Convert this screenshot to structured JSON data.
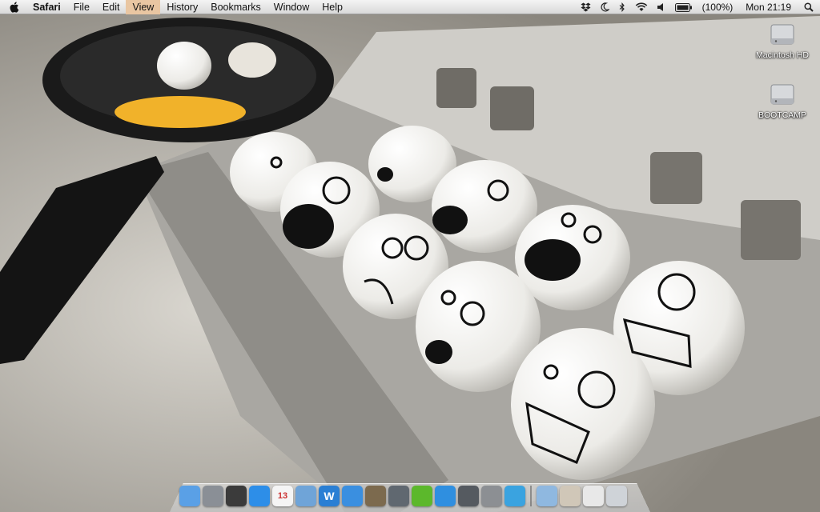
{
  "menubar": {
    "app_name": "Safari",
    "menus": [
      "File",
      "Edit",
      "View",
      "History",
      "Bookmarks",
      "Window",
      "Help"
    ],
    "highlighted_menu": "View",
    "status": {
      "battery": "(100%)",
      "clock": "Mon 21:19"
    },
    "status_icons": [
      "dropbox-icon",
      "moon-icon",
      "bluetooth-icon",
      "wifi-icon",
      "volume-icon",
      "battery-icon",
      "spotlight-icon"
    ]
  },
  "desktop": {
    "drives": [
      {
        "label": "Macintosh HD"
      },
      {
        "label": "BOOTCAMP"
      }
    ]
  },
  "dock": {
    "apps": [
      {
        "name": "finder-icon",
        "color": "#5aa0e6"
      },
      {
        "name": "launchpad-icon",
        "color": "#8a8f96"
      },
      {
        "name": "mission-control-icon",
        "color": "#3b3b3b"
      },
      {
        "name": "app-store-icon",
        "color": "#2d8ee8"
      },
      {
        "name": "calendar-icon",
        "color": "#f5f5f5",
        "text": "13"
      },
      {
        "name": "preview-icon",
        "color": "#6fa4d8"
      },
      {
        "name": "word-icon",
        "color": "#2a7fd4",
        "text": "W"
      },
      {
        "name": "safari-icon",
        "color": "#3a8fe0"
      },
      {
        "name": "iphoto-icon",
        "color": "#7c6a4e"
      },
      {
        "name": "facetime-icon",
        "color": "#606870"
      },
      {
        "name": "spotify-icon",
        "color": "#5cb82c"
      },
      {
        "name": "itunes-icon",
        "color": "#2f8fe0"
      },
      {
        "name": "steam-icon",
        "color": "#555a60"
      },
      {
        "name": "system-preferences-icon",
        "color": "#8c8f93"
      },
      {
        "name": "twitter-icon",
        "color": "#3aa3e0"
      }
    ],
    "right": [
      {
        "name": "downloads-folder-icon",
        "color": "#8fb8e0"
      },
      {
        "name": "documents-stack-icon",
        "color": "#d0c7b8"
      },
      {
        "name": "screenshots-stack-icon",
        "color": "#e8e8e8"
      },
      {
        "name": "trash-icon",
        "color": "#cfd3d8"
      }
    ]
  }
}
